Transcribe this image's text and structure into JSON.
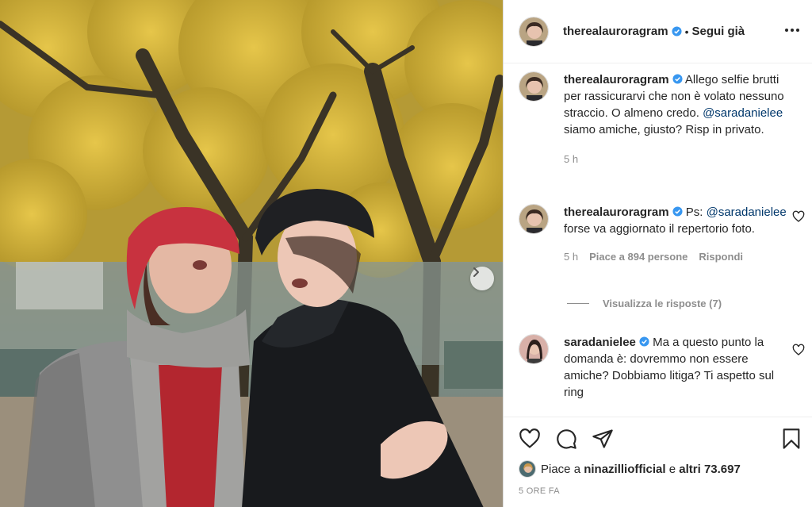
{
  "post": {
    "author": "therealauroragram",
    "separator": "•",
    "follow_label": "Segui già"
  },
  "comments": [
    {
      "username": "therealauroragram",
      "text_part1": "Allego selfie brutti per rassicurarvi che non è volato nessuno straccio. O almeno credo.",
      "mention": "@saradanielee",
      "text_part2": "siamo amiche, giusto? Risp in privato.",
      "time": "5 h"
    },
    {
      "username": "therealauroragram",
      "text_part1": "Ps:",
      "mention": "@saradanielee",
      "text_part2": "forse va aggiornato il repertorio foto.",
      "time": "5 h",
      "likes": "Piace a 894 persone",
      "reply": "Rispondi",
      "view_replies": "Visualizza le risposte (7)"
    },
    {
      "username": "saradanielee",
      "text": "Ma a questo punto la domanda è: dovremmo non essere amiche? Dobbiamo litiga? Ti aspetto sul ring"
    }
  ],
  "likes_bar": {
    "prefix": "Piace a",
    "liker": "ninazilliofficial",
    "middle": "e",
    "others": "altri 73.697"
  },
  "timestamp": "5 ORE FA",
  "icons": [
    "more-icon",
    "verified-icon",
    "heart-icon",
    "comment-icon",
    "share-icon",
    "bookmark-icon",
    "chevron-right-icon"
  ],
  "colors": {
    "verified": "#3897f0",
    "mention": "#00376b",
    "secondary": "#8e8e8e",
    "beret_red": "#c8323f"
  }
}
